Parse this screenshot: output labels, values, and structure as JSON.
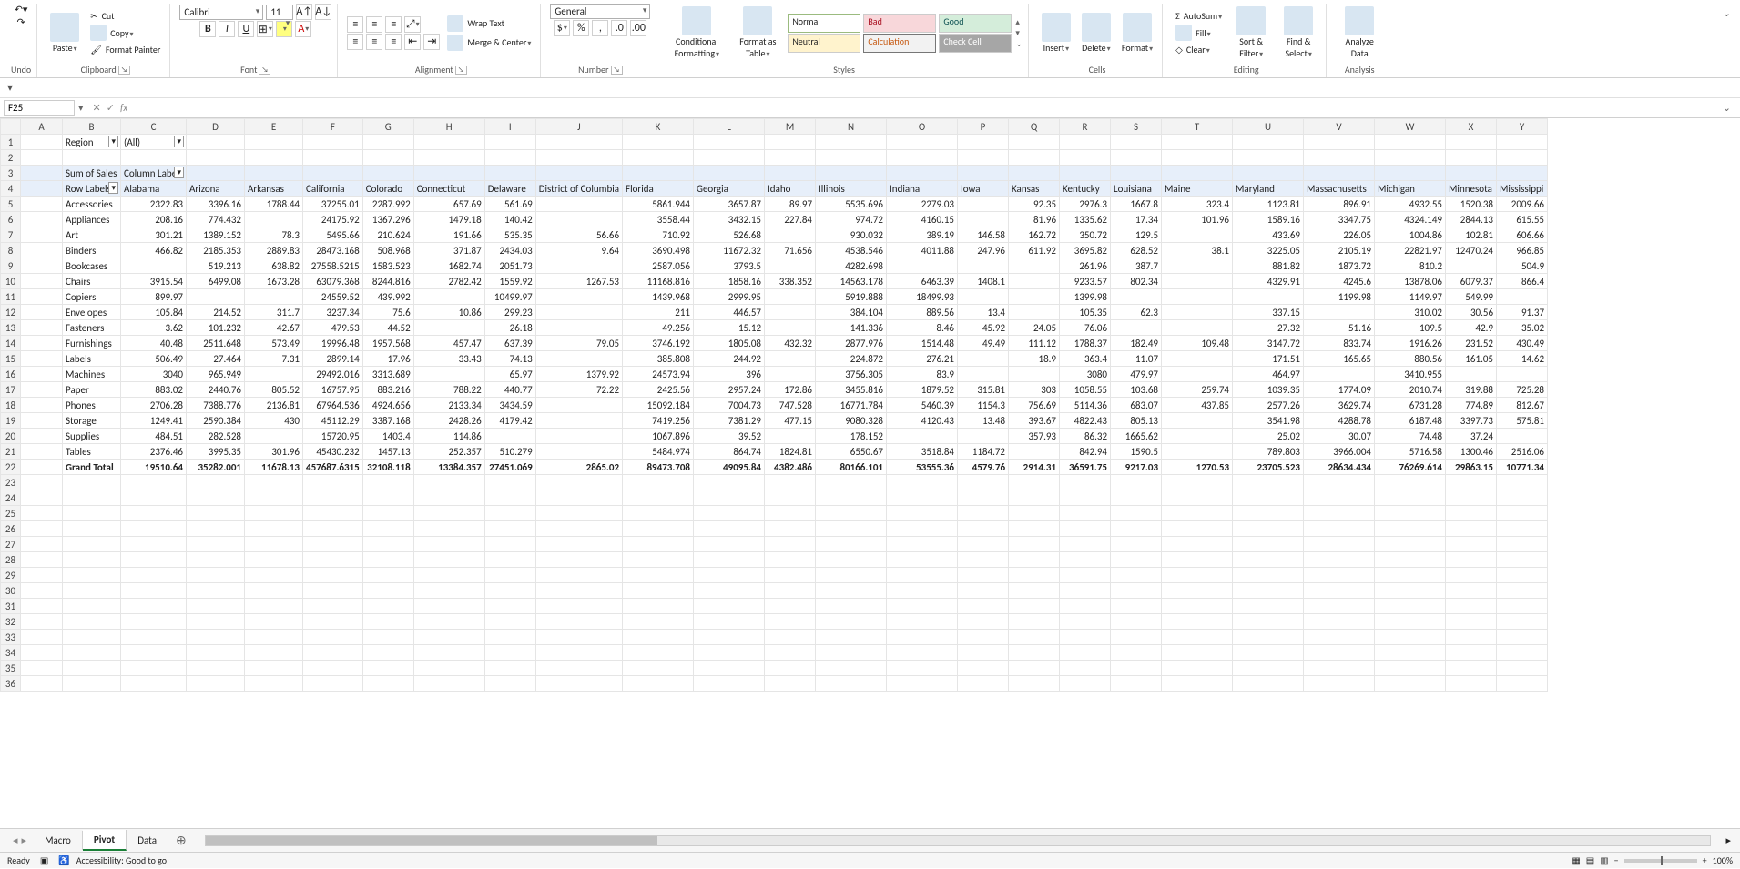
{
  "ribbon": {
    "undo": "Undo",
    "clipboard": {
      "paste": "Paste",
      "cut": "Cut",
      "copy": "Copy",
      "painter": "Format Painter",
      "label": "Clipboard"
    },
    "font": {
      "name": "Calibri",
      "size": "11",
      "label": "Font"
    },
    "align": {
      "wrap": "Wrap Text",
      "merge": "Merge & Center",
      "label": "Alignment"
    },
    "number": {
      "fmt": "General",
      "label": "Number"
    },
    "styles": {
      "cond": "Conditional Formatting",
      "fat": "Format as Table",
      "normal": "Normal",
      "bad": "Bad",
      "good": "Good",
      "neutral": "Neutral",
      "calc": "Calculation",
      "check": "Check Cell",
      "label": "Styles"
    },
    "cells": {
      "ins": "Insert",
      "del": "Delete",
      "fmt": "Format",
      "label": "Cells"
    },
    "editing": {
      "auto": "AutoSum",
      "fill": "Fill",
      "clear": "Clear",
      "sort": "Sort & Filter",
      "find": "Find & Select",
      "label": "Editing"
    },
    "analysis": {
      "analyze": "Analyze Data",
      "label": "Analysis"
    }
  },
  "namebox": "F25",
  "filter": {
    "region": "Region",
    "all": "(All)"
  },
  "pivot": {
    "sum": "Sum of Sales",
    "collabels": "Column Labels",
    "rowlabels": "Row Labels",
    "grand": "Grand Total"
  },
  "cols": [
    "Alabama",
    "Arizona",
    "Arkansas",
    "California",
    "Colorado",
    "Connecticut",
    "Delaware",
    "District of Columbia",
    "Florida",
    "Georgia",
    "Idaho",
    "Illinois",
    "Indiana",
    "Iowa",
    "Kansas",
    "Kentucky",
    "Louisiana",
    "Maine",
    "Maryland",
    "Massachusetts",
    "Michigan",
    "Minnesota",
    "Mississippi"
  ],
  "rows": [
    {
      "n": "Accessories",
      "v": [
        "2322.83",
        "3396.16",
        "1788.44",
        "37255.01",
        "2287.992",
        "657.69",
        "561.69",
        "",
        "5861.944",
        "3657.87",
        "89.97",
        "5535.696",
        "2279.03",
        "",
        "92.35",
        "2976.3",
        "1667.8",
        "323.4",
        "1123.81",
        "896.91",
        "4932.55",
        "1520.38",
        "2009.66"
      ]
    },
    {
      "n": "Appliances",
      "v": [
        "208.16",
        "774.432",
        "",
        "24175.92",
        "1367.296",
        "1479.18",
        "140.42",
        "",
        "3558.44",
        "3432.15",
        "227.84",
        "974.72",
        "4160.15",
        "",
        "81.96",
        "1335.62",
        "17.34",
        "101.96",
        "1589.16",
        "3347.75",
        "4324.149",
        "2844.13",
        "615.55"
      ]
    },
    {
      "n": "Art",
      "v": [
        "301.21",
        "1389.152",
        "78.3",
        "5495.66",
        "210.624",
        "191.66",
        "535.35",
        "56.66",
        "710.92",
        "526.68",
        "",
        "930.032",
        "389.19",
        "146.58",
        "162.72",
        "350.72",
        "129.5",
        "",
        "433.69",
        "226.05",
        "1004.86",
        "102.81",
        "606.66"
      ]
    },
    {
      "n": "Binders",
      "v": [
        "466.82",
        "2185.353",
        "2889.83",
        "28473.168",
        "508.968",
        "371.87",
        "2434.03",
        "9.64",
        "3690.498",
        "11672.32",
        "71.656",
        "4538.546",
        "4011.88",
        "247.96",
        "611.92",
        "3695.82",
        "628.52",
        "38.1",
        "3225.05",
        "2105.19",
        "22821.97",
        "12470.24",
        "966.85"
      ]
    },
    {
      "n": "Bookcases",
      "v": [
        "",
        "519.213",
        "638.82",
        "27558.5215",
        "1583.523",
        "1682.74",
        "2051.73",
        "",
        "2587.056",
        "3793.5",
        "",
        "4282.698",
        "",
        "",
        "",
        "261.96",
        "387.7",
        "",
        "881.82",
        "1873.72",
        "810.2",
        "",
        "504.9"
      ]
    },
    {
      "n": "Chairs",
      "v": [
        "3915.54",
        "6499.08",
        "1673.28",
        "63079.368",
        "8244.816",
        "2782.42",
        "1559.92",
        "1267.53",
        "11168.816",
        "1858.16",
        "338.352",
        "14563.178",
        "6463.39",
        "1408.1",
        "",
        "9233.57",
        "802.34",
        "",
        "4329.91",
        "4245.6",
        "13878.06",
        "6079.37",
        "866.4"
      ]
    },
    {
      "n": "Copiers",
      "v": [
        "899.97",
        "",
        "",
        "24559.52",
        "439.992",
        "",
        "10499.97",
        "",
        "1439.968",
        "2999.95",
        "",
        "5919.888",
        "18499.93",
        "",
        "",
        "1399.98",
        "",
        "",
        "",
        "1199.98",
        "1149.97",
        "549.99",
        ""
      ]
    },
    {
      "n": "Envelopes",
      "v": [
        "105.84",
        "214.52",
        "311.7",
        "3237.34",
        "75.6",
        "10.86",
        "299.23",
        "",
        "211",
        "446.57",
        "",
        "384.104",
        "889.56",
        "13.4",
        "",
        "105.35",
        "62.3",
        "",
        "337.15",
        "",
        "310.02",
        "30.56",
        "91.37"
      ]
    },
    {
      "n": "Fasteners",
      "v": [
        "3.62",
        "101.232",
        "42.67",
        "479.53",
        "44.52",
        "",
        "26.18",
        "",
        "49.256",
        "15.12",
        "",
        "141.336",
        "8.46",
        "45.92",
        "24.05",
        "76.06",
        "",
        "",
        "27.32",
        "51.16",
        "109.5",
        "42.9",
        "35.02"
      ]
    },
    {
      "n": "Furnishings",
      "v": [
        "40.48",
        "2511.648",
        "573.49",
        "19996.48",
        "1957.568",
        "457.47",
        "637.39",
        "79.05",
        "3746.192",
        "1805.08",
        "432.32",
        "2877.976",
        "1514.48",
        "49.49",
        "111.12",
        "1788.37",
        "182.49",
        "109.48",
        "3147.72",
        "833.74",
        "1916.26",
        "231.52",
        "430.49"
      ]
    },
    {
      "n": "Labels",
      "v": [
        "506.49",
        "27.464",
        "7.31",
        "2899.14",
        "17.96",
        "33.43",
        "74.13",
        "",
        "385.808",
        "244.92",
        "",
        "224.872",
        "276.21",
        "",
        "18.9",
        "363.4",
        "11.07",
        "",
        "171.51",
        "165.65",
        "880.56",
        "161.05",
        "14.62"
      ]
    },
    {
      "n": "Machines",
      "v": [
        "3040",
        "965.949",
        "",
        "29492.016",
        "3313.689",
        "",
        "65.97",
        "1379.92",
        "24573.94",
        "396",
        "",
        "3756.305",
        "83.9",
        "",
        "",
        "3080",
        "479.97",
        "",
        "464.97",
        "",
        "3410.955",
        "",
        ""
      ]
    },
    {
      "n": "Paper",
      "v": [
        "883.02",
        "2440.76",
        "805.52",
        "16757.95",
        "883.216",
        "788.22",
        "440.77",
        "72.22",
        "2425.56",
        "2957.24",
        "172.86",
        "3455.816",
        "1879.52",
        "315.81",
        "303",
        "1058.55",
        "103.68",
        "259.74",
        "1039.35",
        "1774.09",
        "2010.74",
        "319.88",
        "725.28"
      ]
    },
    {
      "n": "Phones",
      "v": [
        "2706.28",
        "7388.776",
        "2136.81",
        "67964.536",
        "4924.656",
        "2133.34",
        "3434.59",
        "",
        "15092.184",
        "7004.73",
        "747.528",
        "16771.784",
        "5460.39",
        "1154.3",
        "756.69",
        "5114.36",
        "683.07",
        "437.85",
        "2577.26",
        "3629.74",
        "6731.28",
        "774.89",
        "812.67"
      ]
    },
    {
      "n": "Storage",
      "v": [
        "1249.41",
        "2590.384",
        "430",
        "45112.29",
        "3387.168",
        "2428.26",
        "4179.42",
        "",
        "7419.256",
        "7381.29",
        "477.15",
        "9080.328",
        "4120.43",
        "13.48",
        "393.67",
        "4822.43",
        "805.13",
        "",
        "3541.98",
        "4288.78",
        "6187.48",
        "3397.73",
        "575.81"
      ]
    },
    {
      "n": "Supplies",
      "v": [
        "484.51",
        "282.528",
        "",
        "15720.95",
        "1403.4",
        "114.86",
        "",
        "",
        "1067.896",
        "39.52",
        "",
        "178.152",
        "",
        "",
        "357.93",
        "86.32",
        "1665.62",
        "",
        "25.02",
        "30.07",
        "74.48",
        "37.24",
        ""
      ]
    },
    {
      "n": "Tables",
      "v": [
        "2376.46",
        "3995.35",
        "301.96",
        "45430.232",
        "1457.13",
        "252.357",
        "510.279",
        "",
        "5484.974",
        "864.74",
        "1824.81",
        "6550.67",
        "3518.84",
        "1184.72",
        "",
        "842.94",
        "1590.5",
        "",
        "789.803",
        "3966.004",
        "5716.58",
        "1300.46",
        "2516.06"
      ]
    }
  ],
  "grand": [
    "19510.64",
    "35282.001",
    "11678.13",
    "457687.6315",
    "32108.118",
    "13384.357",
    "27451.069",
    "2865.02",
    "89473.708",
    "49095.84",
    "4382.486",
    "80166.101",
    "53555.36",
    "4579.76",
    "2914.31",
    "36591.75",
    "9217.03",
    "1270.53",
    "23705.523",
    "28634.434",
    "76269.614",
    "29863.15",
    "10771.34"
  ],
  "tabs": {
    "macro": "Macro",
    "pivot": "Pivot",
    "data": "Data"
  },
  "status": {
    "ready": "Ready",
    "acc": "Accessibility: Good to go",
    "zoom": "100%"
  }
}
